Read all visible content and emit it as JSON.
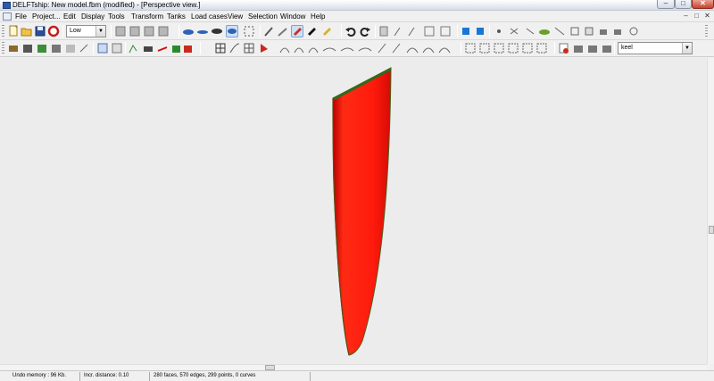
{
  "window": {
    "title": "DELFTship: New model.fbm (modified) - [Perspective view.]",
    "minimize_glyph": "–",
    "maximize_glyph": "□",
    "close_glyph": "✕"
  },
  "menu": {
    "items": [
      "File",
      "Project...",
      "Edit",
      "Display",
      "Tools",
      "Transform",
      "Tanks",
      "Load cases",
      "View",
      "Selection",
      "Window",
      "Help"
    ],
    "mdi_controls": [
      "–",
      "□",
      "✕"
    ]
  },
  "toolbar": {
    "precision_select": "Low",
    "layer_select": "keel",
    "icons": [
      "new-file-icon",
      "open-folder-icon",
      "save-icon",
      "help-ring-icon"
    ]
  },
  "status": {
    "undo_memory": "Undo memory : 96 Kb.",
    "incr_distance": "Incr. distance: 0.10",
    "geometry_info": "280 faces, 570 edges, 299 points, 0 curves"
  },
  "model": {
    "surface_color": "#ff1a0d",
    "edge_color": "#2f6b1c"
  }
}
